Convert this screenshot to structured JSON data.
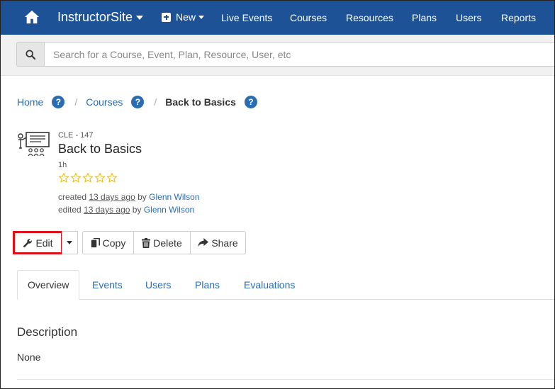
{
  "navbar": {
    "brand": "InstructorSite",
    "new_label": "New",
    "links": [
      "Live Events",
      "Courses",
      "Resources",
      "Plans",
      "Users",
      "Reports"
    ]
  },
  "search": {
    "placeholder": "Search for a Course, Event, Plan, Resource, User, etc"
  },
  "breadcrumb": {
    "home": "Home",
    "courses": "Courses",
    "current": "Back to Basics",
    "help": "?"
  },
  "course": {
    "code": "CLE - 147",
    "title": "Back to Basics",
    "duration": "1h",
    "rating": 0,
    "created_prefix": "created",
    "created_when": "13 days ago",
    "created_by": "by",
    "created_user": "Glenn Wilson",
    "edited_prefix": "edited",
    "edited_when": "13 days ago",
    "edited_by": "by",
    "edited_user": "Glenn Wilson"
  },
  "actions": {
    "edit": "Edit",
    "copy": "Copy",
    "delete": "Delete",
    "share": "Share"
  },
  "tabs": [
    "Overview",
    "Events",
    "Users",
    "Plans",
    "Evaluations"
  ],
  "description": {
    "title": "Description",
    "body": "None"
  },
  "colors": {
    "navbar": "#1e5297",
    "link": "#2a6db5",
    "highlight": "#e0101b",
    "star": "#f0c419"
  }
}
